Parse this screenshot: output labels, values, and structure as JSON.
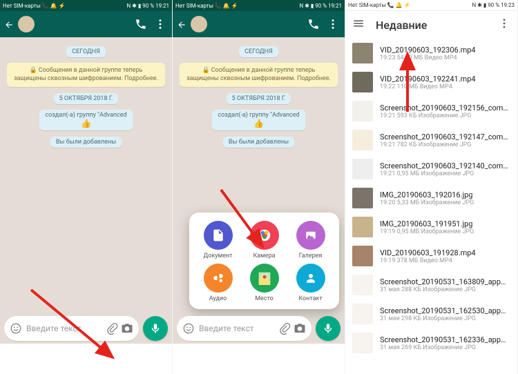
{
  "status": {
    "left_text": "Нет SIM-карты",
    "icons": "📞 🔔 ⚡",
    "nfc": "N",
    "bt": "✱",
    "batt": "90 %",
    "time12": "19:21",
    "time3": "19:23"
  },
  "wa": {
    "today": "СЕГОДНЯ",
    "encrypt": "Сообщения в данной группе теперь защищены сквозным шифрованием. Подробнее.",
    "date": "5 ОКТЯБРЯ 2018 Г.",
    "created": "создал(-а) группу \"Advanced ",
    "thumbs": "👍",
    "added": "Вы были добавлены",
    "placeholder": "Введите текст"
  },
  "attach": {
    "document": "Документ",
    "camera": "Камера",
    "gallery": "Галерея",
    "audio": "Аудио",
    "location": "Место",
    "contact": "Контакт"
  },
  "picker": {
    "title": "Недавние",
    "files": [
      {
        "name": "VID_20190603_192306.mp4",
        "meta": "19:23 54,50 МБ Видео MP4",
        "thumb": "#8a8470"
      },
      {
        "name": "VID_20190603_192241.mp4",
        "meta": "19:22 110 МБ Видео MP4",
        "thumb": "#6e6a5c"
      },
      {
        "name": "Screenshot_20190603_192156_com…",
        "meta": "19:21 593 КБ Изображение JPG",
        "thumb": "#f3f1ec"
      },
      {
        "name": "Screenshot_20190603_192147_com…",
        "meta": "19:21 782 КБ Изображение JPG",
        "thumb": "#f5eedd"
      },
      {
        "name": "Screenshot_20190603_192140_com…",
        "meta": "19:21 0,95 МБ Изображение JPG",
        "thumb": "#eee"
      },
      {
        "name": "IMG_20190603_192016.jpg",
        "meta": "19:20 5,33 МБ Изображение JPG",
        "thumb": "#7b746a"
      },
      {
        "name": "IMG_20190603_191951.jpg",
        "meta": "19:19 0,95 МБ Изображение JPG",
        "thumb": "#c9b38c"
      },
      {
        "name": "VID_20190603_191928.mp4",
        "meta": "19:19 378 МБ Видео MP4",
        "thumb": "#a6836a"
      },
      {
        "name": "Screenshot_20190531_163809_app…",
        "meta": "31 мая 288 КБ Изображение JPG",
        "thumb": "#f7f3ee"
      },
      {
        "name": "Screenshot_20190531_162530_app…",
        "meta": "31 мая 298 КБ Изображение JPG",
        "thumb": "#f7f3ee"
      },
      {
        "name": "Screenshot_20190531_162336_app…",
        "meta": "31 мая 269 КБ Изображение JPG",
        "thumb": "#f7f3ee"
      }
    ]
  }
}
